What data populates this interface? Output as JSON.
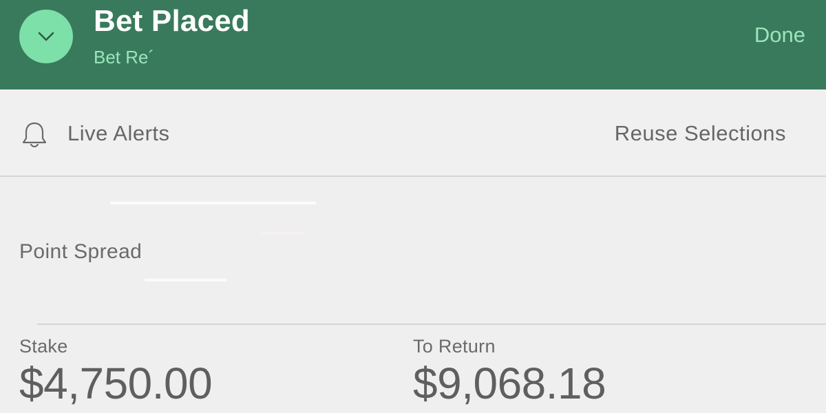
{
  "header": {
    "title": "Bet Placed",
    "subtitle": "Bet Re´",
    "done_label": "Done",
    "collapse_icon": "chevron-down-icon",
    "background_color": "#3a7a5c",
    "accent_color": "#7ee0a9"
  },
  "actions": {
    "live_alerts_label": "Live Alerts",
    "live_alerts_icon": "bell-icon",
    "reuse_label": "Reuse Selections"
  },
  "selection": {
    "market": "Point Spread"
  },
  "bet": {
    "stake_label": "Stake",
    "stake_value": "$4,750.00",
    "return_label": "To Return",
    "return_value": "$9,068.18"
  }
}
